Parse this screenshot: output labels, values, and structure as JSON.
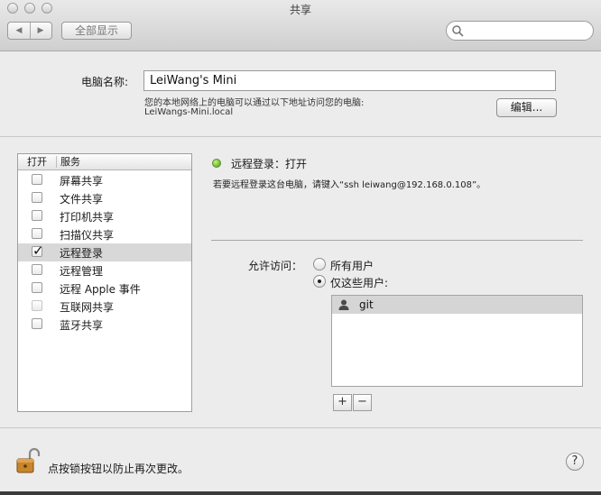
{
  "window": {
    "title": "共享"
  },
  "toolbar": {
    "back_glyph": "◀",
    "forward_glyph": "▶",
    "show_all_label": "全部显示",
    "search_placeholder": "",
    "search_icon": "search-icon"
  },
  "computer": {
    "name_label": "电脑名称:",
    "name_value": "LeiWang's Mini",
    "address_desc": "您的本地网络上的电脑可以通过以下地址访问您的电脑:",
    "address_value": "LeiWangs-Mini.local",
    "edit_button": "编辑..."
  },
  "services": {
    "header_on": "打开",
    "header_service": "服务",
    "items": [
      {
        "label": "屏幕共享",
        "checked": false,
        "selected": false,
        "disabled": false
      },
      {
        "label": "文件共享",
        "checked": false,
        "selected": false,
        "disabled": false
      },
      {
        "label": "打印机共享",
        "checked": false,
        "selected": false,
        "disabled": false
      },
      {
        "label": "扫描仪共享",
        "checked": false,
        "selected": false,
        "disabled": false
      },
      {
        "label": "远程登录",
        "checked": true,
        "selected": true,
        "disabled": false
      },
      {
        "label": "远程管理",
        "checked": false,
        "selected": false,
        "disabled": false
      },
      {
        "label": "远程 Apple 事件",
        "checked": false,
        "selected": false,
        "disabled": false
      },
      {
        "label": "互联网共享",
        "checked": false,
        "selected": false,
        "disabled": true
      },
      {
        "label": "蓝牙共享",
        "checked": false,
        "selected": false,
        "disabled": false
      }
    ]
  },
  "detail": {
    "status_text": "远程登录：打开",
    "status_color": "#4caf20",
    "ssh_hint": "若要远程登录这台电脑，请键入“ssh leiwang@192.168.0.108”。",
    "access_label": "允许访问：",
    "radio_all_users": "所有用户",
    "radio_only_users": "仅这些用户:",
    "selected_option": "only_users",
    "users": [
      {
        "name": "git",
        "icon": "user-icon"
      }
    ],
    "add_glyph": "+",
    "remove_glyph": "−"
  },
  "footer": {
    "lock_text": "点按锁按钮以防止再次更改。",
    "lock_icon": "unlocked-padlock-icon",
    "help_glyph": "?"
  }
}
